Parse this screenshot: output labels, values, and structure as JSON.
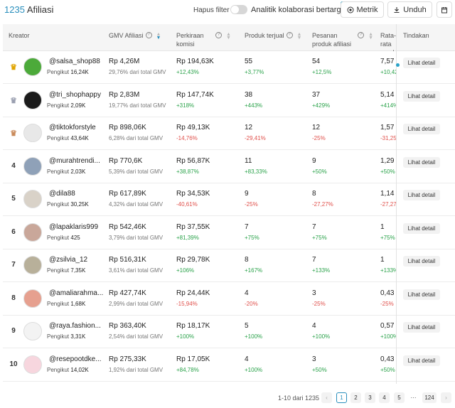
{
  "header": {
    "count": "1235",
    "title": "Afiliasi",
    "hapus_filter": "Hapus filter",
    "analitik_label": "Analitik kolaborasi bertarget",
    "metrik_label": "Metrik",
    "unduh_label": "Unduh"
  },
  "columns": [
    {
      "label": "Kreator"
    },
    {
      "label": "GMV Afiliasi"
    },
    {
      "label": "Perkiraan komisi"
    },
    {
      "label": "Produk terjual"
    },
    {
      "label": "Pesanan produk afiliasi"
    },
    {
      "label": "Rata-rata pemb"
    },
    {
      "label": "Tindakan"
    }
  ],
  "rows": [
    {
      "rank": "",
      "crown": "gold",
      "handle": "@salsa_shop88",
      "followers_label": "Pengikut",
      "followers": "16,24K",
      "gmv": "Rp 4,26M",
      "gmv_share": "29,76% dari total GMV",
      "komisi": "Rp 194,63K",
      "komisi_change": "+12,43%",
      "komisi_dir": "up",
      "produk": "55",
      "produk_change": "+3,77%",
      "produk_dir": "up",
      "pesanan": "54",
      "pesanan_change": "+12,5%",
      "pesanan_dir": "up",
      "rata": "7,57",
      "rata_change": "+10,42",
      "rata_dir": "up",
      "action": "Lihat detail",
      "avatar_color": "#4caa3a"
    },
    {
      "rank": "",
      "crown": "silver",
      "handle": "@tri_shophappy",
      "followers_label": "Pengikut",
      "followers": "2,09K",
      "gmv": "Rp 2,83M",
      "gmv_share": "19,77% dari total GMV",
      "komisi": "Rp 147,74K",
      "komisi_change": "+318%",
      "komisi_dir": "up",
      "produk": "38",
      "produk_change": "+443%",
      "produk_dir": "up",
      "pesanan": "37",
      "pesanan_change": "+429%",
      "pesanan_dir": "up",
      "rata": "5,14",
      "rata_change": "+414%",
      "rata_dir": "up",
      "action": "Lihat detail",
      "avatar_color": "#1b1b1b"
    },
    {
      "rank": "",
      "crown": "bronze",
      "handle": "@tiktokforstyle",
      "followers_label": "Pengikut",
      "followers": "43,64K",
      "gmv": "Rp 898,06K",
      "gmv_share": "6,28% dari total GMV",
      "komisi": "Rp 49,13K",
      "komisi_change": "-14,76%",
      "komisi_dir": "down",
      "produk": "12",
      "produk_change": "-29,41%",
      "produk_dir": "down",
      "pesanan": "12",
      "pesanan_change": "-25%",
      "pesanan_dir": "down",
      "rata": "1,57",
      "rata_change": "-31,25",
      "rata_dir": "down",
      "action": "Lihat detail",
      "avatar_color": "#e8e8e8"
    },
    {
      "rank": "4",
      "crown": "",
      "handle": "@murahtrendi...",
      "followers_label": "Pengikut",
      "followers": "2,03K",
      "gmv": "Rp 770,6K",
      "gmv_share": "5,39% dari total GMV",
      "komisi": "Rp 56,87K",
      "komisi_change": "+38,87%",
      "komisi_dir": "up",
      "produk": "11",
      "produk_change": "+83,33%",
      "produk_dir": "up",
      "pesanan": "9",
      "pesanan_change": "+50%",
      "pesanan_dir": "up",
      "rata": "1,29",
      "rata_change": "+50%",
      "rata_dir": "up",
      "action": "Lihat detail",
      "avatar_color": "#8fa1b8"
    },
    {
      "rank": "5",
      "crown": "",
      "handle": "@dila88",
      "followers_label": "Pengikut",
      "followers": "30,25K",
      "gmv": "Rp 617,89K",
      "gmv_share": "4,32% dari total GMV",
      "komisi": "Rp 34,53K",
      "komisi_change": "-40,61%",
      "komisi_dir": "down",
      "produk": "9",
      "produk_change": "-25%",
      "produk_dir": "down",
      "pesanan": "8",
      "pesanan_change": "-27,27%",
      "pesanan_dir": "down",
      "rata": "1,14",
      "rata_change": "-27,27",
      "rata_dir": "down",
      "action": "Lihat detail",
      "avatar_color": "#d9d2c8"
    },
    {
      "rank": "6",
      "crown": "",
      "handle": "@lapaklaris999",
      "followers_label": "Pengikut",
      "followers": "425",
      "gmv": "Rp 542,46K",
      "gmv_share": "3,79% dari total GMV",
      "komisi": "Rp 37,55K",
      "komisi_change": "+81,39%",
      "komisi_dir": "up",
      "produk": "7",
      "produk_change": "+75%",
      "produk_dir": "up",
      "pesanan": "7",
      "pesanan_change": "+75%",
      "pesanan_dir": "up",
      "rata": "1",
      "rata_change": "+75%",
      "rata_dir": "up",
      "action": "Lihat detail",
      "avatar_color": "#c9a79a"
    },
    {
      "rank": "7",
      "crown": "",
      "handle": "@zsilvia_12",
      "followers_label": "Pengikut",
      "followers": "7,35K",
      "gmv": "Rp 516,31K",
      "gmv_share": "3,61% dari total GMV",
      "komisi": "Rp 29,78K",
      "komisi_change": "+106%",
      "komisi_dir": "up",
      "produk": "8",
      "produk_change": "+167%",
      "produk_dir": "up",
      "pesanan": "7",
      "pesanan_change": "+133%",
      "pesanan_dir": "up",
      "rata": "1",
      "rata_change": "+133%",
      "rata_dir": "up",
      "action": "Lihat detail",
      "avatar_color": "#b8b09a"
    },
    {
      "rank": "8",
      "crown": "",
      "handle": "@amaliarahma...",
      "followers_label": "Pengikut",
      "followers": "1,68K",
      "gmv": "Rp 427,74K",
      "gmv_share": "2,99% dari total GMV",
      "komisi": "Rp 24,44K",
      "komisi_change": "-15,94%",
      "komisi_dir": "down",
      "produk": "4",
      "produk_change": "-20%",
      "produk_dir": "down",
      "pesanan": "3",
      "pesanan_change": "-25%",
      "pesanan_dir": "down",
      "rata": "0,43",
      "rata_change": "-25%",
      "rata_dir": "down",
      "action": "Lihat detail",
      "avatar_color": "#e6a08f"
    },
    {
      "rank": "9",
      "crown": "",
      "handle": "@raya.fashion...",
      "followers_label": "Pengikut",
      "followers": "3,31K",
      "gmv": "Rp 363,40K",
      "gmv_share": "2,54% dari total GMV",
      "komisi": "Rp 18,17K",
      "komisi_change": "+100%",
      "komisi_dir": "up",
      "produk": "5",
      "produk_change": "+100%",
      "produk_dir": "up",
      "pesanan": "4",
      "pesanan_change": "+100%",
      "pesanan_dir": "up",
      "rata": "0,57",
      "rata_change": "+100%",
      "rata_dir": "up",
      "action": "Lihat detail",
      "avatar_color": "#f3f3f3"
    },
    {
      "rank": "10",
      "crown": "",
      "handle": "@resepootdke...",
      "followers_label": "Pengikut",
      "followers": "14,02K",
      "gmv": "Rp 275,33K",
      "gmv_share": "1,92% dari total GMV",
      "komisi": "Rp 17,05K",
      "komisi_change": "+84,78%",
      "komisi_dir": "up",
      "produk": "4",
      "produk_change": "+100%",
      "produk_dir": "up",
      "pesanan": "3",
      "pesanan_change": "+50%",
      "pesanan_dir": "up",
      "rata": "0,43",
      "rata_change": "+50%",
      "rata_dir": "up",
      "action": "Lihat detail",
      "avatar_color": "#f7d6de"
    }
  ],
  "pagination": {
    "range": "1-10 dari 1235",
    "pages": [
      "1",
      "2",
      "3",
      "4",
      "5",
      "···",
      "124"
    ],
    "active": "1"
  },
  "colors": {
    "accent": "#2a8fbd",
    "positive": "#2aa24a",
    "negative": "#e0504b"
  },
  "icons": {
    "metrik": "eye-icon",
    "unduh": "download-icon",
    "calendar": "calendar-icon",
    "crown": "crown-icon",
    "help": "help-circle-icon",
    "sort": "sort-icon"
  }
}
